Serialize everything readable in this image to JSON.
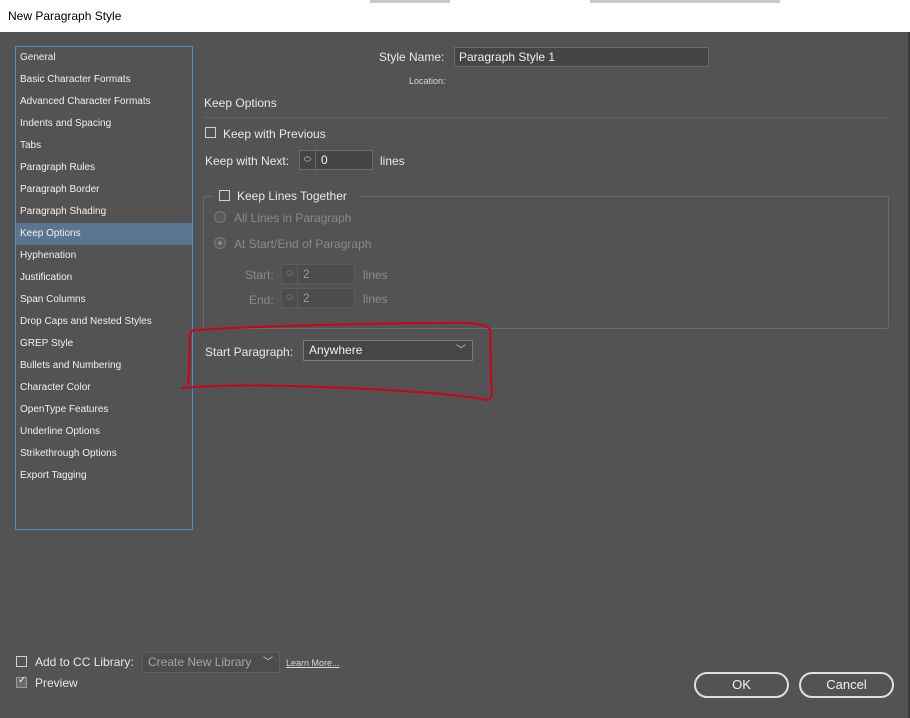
{
  "window": {
    "title": "New Paragraph Style"
  },
  "sidebar": {
    "items": [
      {
        "label": "General"
      },
      {
        "label": "Basic Character Formats"
      },
      {
        "label": "Advanced Character Formats"
      },
      {
        "label": "Indents and Spacing"
      },
      {
        "label": "Tabs"
      },
      {
        "label": "Paragraph Rules"
      },
      {
        "label": "Paragraph Border"
      },
      {
        "label": "Paragraph Shading"
      },
      {
        "label": "Keep Options",
        "selected": true
      },
      {
        "label": "Hyphenation"
      },
      {
        "label": "Justification"
      },
      {
        "label": "Span Columns"
      },
      {
        "label": "Drop Caps and Nested Styles"
      },
      {
        "label": "GREP Style"
      },
      {
        "label": "Bullets and Numbering"
      },
      {
        "label": "Character Color"
      },
      {
        "label": "OpenType Features"
      },
      {
        "label": "Underline Options"
      },
      {
        "label": "Strikethrough Options"
      },
      {
        "label": "Export Tagging"
      }
    ]
  },
  "style": {
    "name_label": "Style Name:",
    "name_value": "Paragraph Style 1",
    "location_label": "Location:"
  },
  "section": {
    "title": "Keep Options"
  },
  "keep": {
    "with_previous_label": "Keep with Previous",
    "with_previous_checked": false,
    "with_next_label": "Keep with Next:",
    "with_next_value": "0",
    "with_next_unit": "lines",
    "lines_together_label": "Keep Lines Together",
    "lines_together_checked": false,
    "all_lines_label": "All Lines in Paragraph",
    "start_end_label": "At Start/End of Paragraph",
    "start_label": "Start:",
    "start_value": "2",
    "start_unit": "lines",
    "end_label": "End:",
    "end_value": "2",
    "end_unit": "lines"
  },
  "start_paragraph": {
    "label": "Start Paragraph:",
    "value": "Anywhere"
  },
  "footer": {
    "add_cc_label": "Add to CC Library:",
    "add_cc_checked": false,
    "library_value": "Create New Library",
    "learn_more": "Learn More...",
    "preview_label": "Preview",
    "preview_checked": true,
    "ok_label": "OK",
    "cancel_label": "Cancel"
  },
  "colors": {
    "background": "#535353",
    "selection": "#5a7592",
    "annotation": "#d0021b",
    "sidebar_border": "#4a8bd6"
  }
}
